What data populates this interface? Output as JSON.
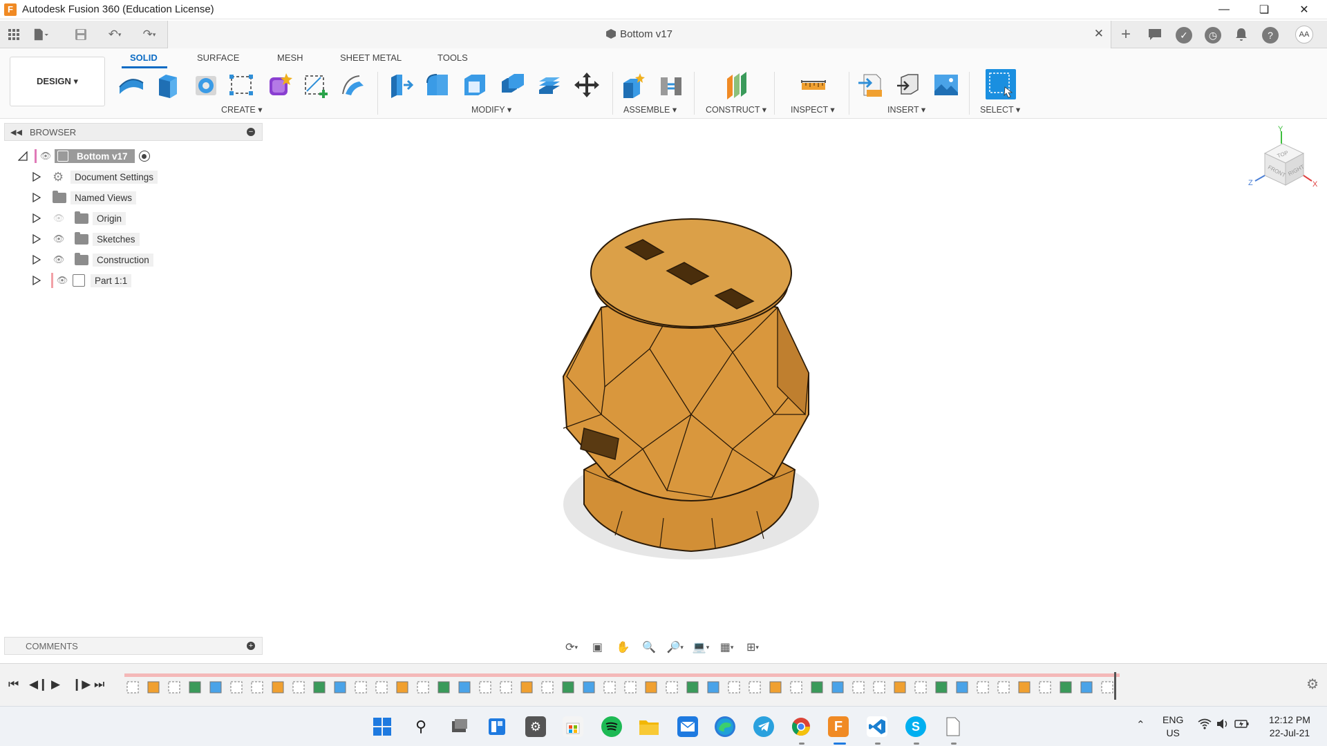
{
  "window": {
    "title": "Autodesk Fusion 360 (Education License)",
    "logo_letter": "F",
    "controls": [
      "minimize-icon",
      "restore-icon",
      "close-icon"
    ]
  },
  "doc_tab": {
    "title": "Bottom v17",
    "close": "✕"
  },
  "user": {
    "initials": "AA"
  },
  "workspace": {
    "label": "DESIGN ▾"
  },
  "ribbon": {
    "tabs": [
      "SOLID",
      "SURFACE",
      "MESH",
      "SHEET METAL",
      "TOOLS"
    ],
    "active_tab": "SOLID",
    "groups": [
      "CREATE ▾",
      "MODIFY ▾",
      "ASSEMBLE ▾",
      "CONSTRUCT ▾",
      "INSPECT ▾",
      "INSERT ▾",
      "SELECT ▾"
    ]
  },
  "browser": {
    "title": "BROWSER",
    "root": "Bottom v17",
    "items": [
      "Document Settings",
      "Named Views",
      "Origin",
      "Sketches",
      "Construction",
      "Part 1:1"
    ]
  },
  "comments": {
    "title": "COMMENTS"
  },
  "viewcube": {
    "faces": [
      "TOP",
      "FRONT",
      "RIGHT"
    ],
    "axes": [
      "Y",
      "Z",
      "X"
    ]
  },
  "taskbar": {
    "lang_line1": "ENG",
    "lang_line2": "US",
    "time": "12:12 PM",
    "date": "22-Jul-21"
  },
  "colors": {
    "accent": "#0a6bc4",
    "model_fill": "#d9973d",
    "model_dark": "#b87a2c",
    "fusion_orange": "#f08a24"
  }
}
